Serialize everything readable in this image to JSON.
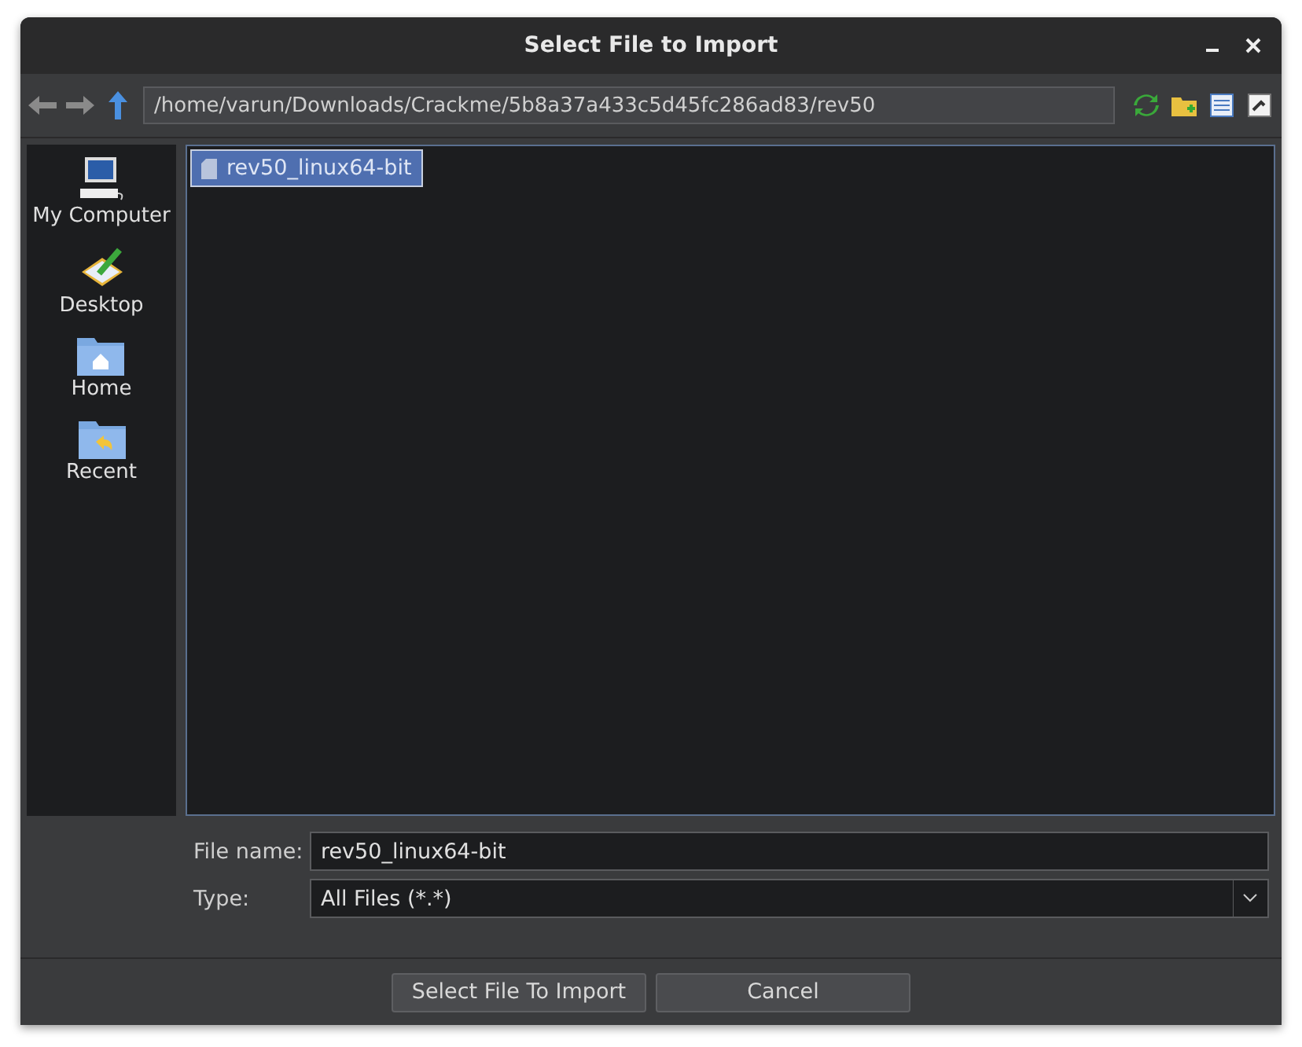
{
  "window": {
    "title": "Select File to Import"
  },
  "toolbar": {
    "path": "/home/varun/Downloads/Crackme/5b8a37a433c5d45fc286ad83/rev50"
  },
  "places": [
    {
      "label": "My Computer",
      "kind": "computer"
    },
    {
      "label": "Desktop",
      "kind": "desktop"
    },
    {
      "label": "Home",
      "kind": "home"
    },
    {
      "label": "Recent",
      "kind": "recent"
    }
  ],
  "files": [
    {
      "name": "rev50_linux64-bit",
      "selected": true
    }
  ],
  "form": {
    "file_name_label": "File name:",
    "file_name": "rev50_linux64-bit",
    "type_label": "Type:",
    "type": "All Files (*.*)"
  },
  "buttons": [
    "Select File To Import",
    "Cancel"
  ]
}
